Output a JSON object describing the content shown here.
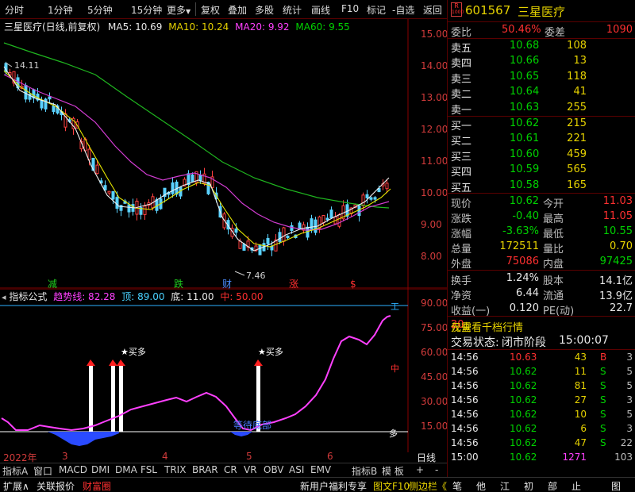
{
  "toolbar": {
    "items": [
      "分时",
      "1分钟",
      "5分钟",
      "15分钟",
      "更多",
      "复权",
      "叠加",
      "多股",
      "统计",
      "画线",
      "F10",
      "标记",
      "-自选",
      "返回"
    ],
    "down_arrow": "▼"
  },
  "chart_title": {
    "stock": "三星医疗(日线,前复权)",
    "ma5_label": "MA5: 10.69",
    "ma10_label": "MA10: 10.24",
    "ma20_label": "MA20: 9.92",
    "ma60_label": "MA60: 9.55"
  },
  "main_axis_ticks": [
    "15.00",
    "14.00",
    "13.00",
    "12.00",
    "11.00",
    "10.00",
    "9.00",
    "8.00"
  ],
  "main_annotations": {
    "high": "14.11",
    "low": "7.46",
    "markers": [
      "减",
      "跌",
      "财",
      "涨",
      "$"
    ]
  },
  "indicator": {
    "name": "指标公式",
    "trend_label": "趋势线: 82.28",
    "top_label": "顶: 89.00",
    "bottom_label": "底: 11.00",
    "mid_label": "中: 50.00",
    "axis_ticks": [
      "90.00",
      "75.00",
      "60.00",
      "45.00",
      "30.00",
      "15.00"
    ],
    "buy_labels": [
      "★买多",
      "★买多"
    ],
    "wait_label": "等待底部",
    "right_marks": [
      "工",
      "中",
      "多"
    ]
  },
  "dates": [
    "2022年",
    "3",
    "4",
    "5",
    "6"
  ],
  "period_label": "日线",
  "tabs": [
    "指标A",
    "窗口",
    "MACD",
    "DMI",
    "DMA",
    "FSL",
    "TRIX",
    "BRAR",
    "CR",
    "VR",
    "OBV",
    "ASI",
    "EMV",
    "指标B",
    "模 板",
    "+",
    "-"
  ],
  "bottom_left": [
    "扩展∧",
    "关联报价",
    "财富圈"
  ],
  "bottom_mid": [
    "新用户福利专享",
    "图文F10",
    "侧边栏《"
  ],
  "bottom_right": [
    "笔",
    "他",
    "江",
    "初",
    "部",
    "止",
    "图"
  ],
  "quote": {
    "badge_top": "R",
    "badge_bot": "1000",
    "code": "601567",
    "name": "三星医疗",
    "weibi_label": "委比",
    "weibi": "50.46%",
    "weicha_label": "委差",
    "weicha": "1090",
    "sell": [
      {
        "label": "卖五",
        "price": "10.68",
        "vol": "108"
      },
      {
        "label": "卖四",
        "price": "10.66",
        "vol": "13"
      },
      {
        "label": "卖三",
        "price": "10.65",
        "vol": "118"
      },
      {
        "label": "卖二",
        "price": "10.64",
        "vol": "41"
      },
      {
        "label": "卖一",
        "price": "10.63",
        "vol": "255"
      }
    ],
    "buy": [
      {
        "label": "买一",
        "price": "10.62",
        "vol": "215"
      },
      {
        "label": "买二",
        "price": "10.61",
        "vol": "221"
      },
      {
        "label": "买三",
        "price": "10.60",
        "vol": "459"
      },
      {
        "label": "买四",
        "price": "10.59",
        "vol": "565"
      },
      {
        "label": "买五",
        "price": "10.58",
        "vol": "165"
      }
    ],
    "stats": [
      {
        "l1": "现价",
        "v1": "10.62",
        "c1": "grn",
        "l2": "今开",
        "v2": "11.03",
        "c2": "red"
      },
      {
        "l1": "涨跌",
        "v1": "-0.40",
        "c1": "grn",
        "l2": "最高",
        "v2": "11.05",
        "c2": "red"
      },
      {
        "l1": "涨幅",
        "v1": "-3.63%",
        "c1": "grn",
        "l2": "最低",
        "v2": "10.55",
        "c2": "grn"
      },
      {
        "l1": "总量",
        "v1": "172511",
        "c1": "yel",
        "l2": "量比",
        "v2": "0.70",
        "c2": "yel"
      },
      {
        "l1": "外盘",
        "v1": "75086",
        "c1": "red",
        "l2": "内盘",
        "v2": "97425",
        "c2": "grn"
      }
    ],
    "stats2": [
      {
        "l1": "换手",
        "v1": "1.24%",
        "l2": "股本",
        "v2": "14.1亿"
      },
      {
        "l1": "净资",
        "v1": "6.44",
        "l2": "流通",
        "v2": "13.9亿"
      },
      {
        "l1": "收益(一)",
        "v1": "0.120",
        "l2": "PE(动)",
        "v2": "22.7"
      }
    ],
    "promo_prefix": "仅需",
    "promo_num": "20",
    "promo_suffix": "元查看千档行情",
    "trade_status_label": "交易状态:",
    "trade_status": "闭市阶段",
    "trade_time": "15:00:07",
    "ticks": [
      {
        "t": "14:56",
        "p": "10.63",
        "v": "43",
        "bs": "B",
        "n": "3"
      },
      {
        "t": "14:56",
        "p": "10.62",
        "v": "11",
        "bs": "S",
        "n": "5"
      },
      {
        "t": "14:56",
        "p": "10.62",
        "v": "81",
        "bs": "S",
        "n": "5"
      },
      {
        "t": "14:56",
        "p": "10.62",
        "v": "27",
        "bs": "S",
        "n": "3"
      },
      {
        "t": "14:56",
        "p": "10.62",
        "v": "10",
        "bs": "S",
        "n": "5"
      },
      {
        "t": "14:56",
        "p": "10.62",
        "v": "6",
        "bs": "S",
        "n": "3"
      },
      {
        "t": "14:56",
        "p": "10.62",
        "v": "47",
        "bs": "S",
        "n": "22"
      },
      {
        "t": "15:00",
        "p": "10.62",
        "v": "1271",
        "bs": "",
        "n": "103"
      }
    ]
  }
}
